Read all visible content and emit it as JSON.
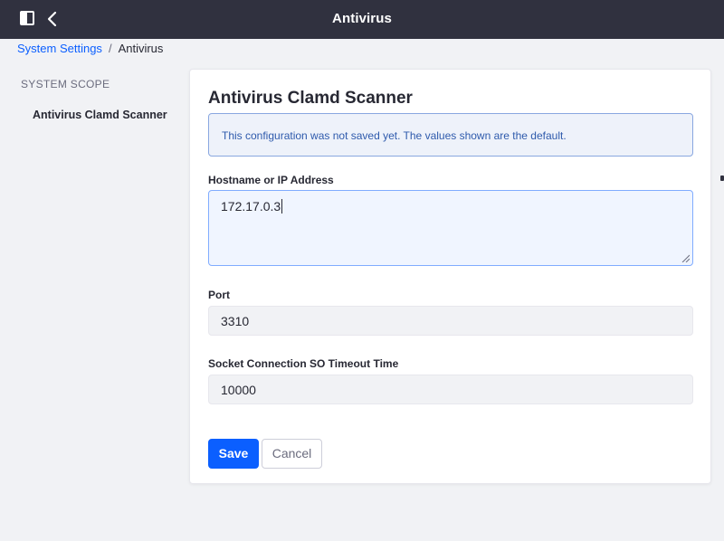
{
  "header": {
    "title": "Antivirus",
    "sidebar_toggle_icon": "sidebar-panel-icon",
    "back_icon": "chevron-left-icon"
  },
  "breadcrumb": {
    "parent": "System Settings",
    "separator": "/",
    "current": "Antivirus"
  },
  "sidebar": {
    "scope_label": "SYSTEM SCOPE",
    "items": [
      {
        "label": "Antivirus Clamd Scanner"
      }
    ]
  },
  "form": {
    "title": "Antivirus Clamd Scanner",
    "alert": "This configuration was not saved yet. The values shown are the default.",
    "hostname": {
      "label": "Hostname or IP Address",
      "value": "172.17.0.3"
    },
    "port": {
      "label": "Port",
      "value": "3310"
    },
    "timeout": {
      "label": "Socket Connection SO Timeout Time",
      "value": "10000"
    },
    "save_label": "Save",
    "cancel_label": "Cancel"
  },
  "colors": {
    "header_bg": "#30313f",
    "primary": "#0b5fff",
    "page_bg": "#f1f2f5",
    "alert_bg": "#eef2fa",
    "alert_text": "#2e5aac"
  }
}
